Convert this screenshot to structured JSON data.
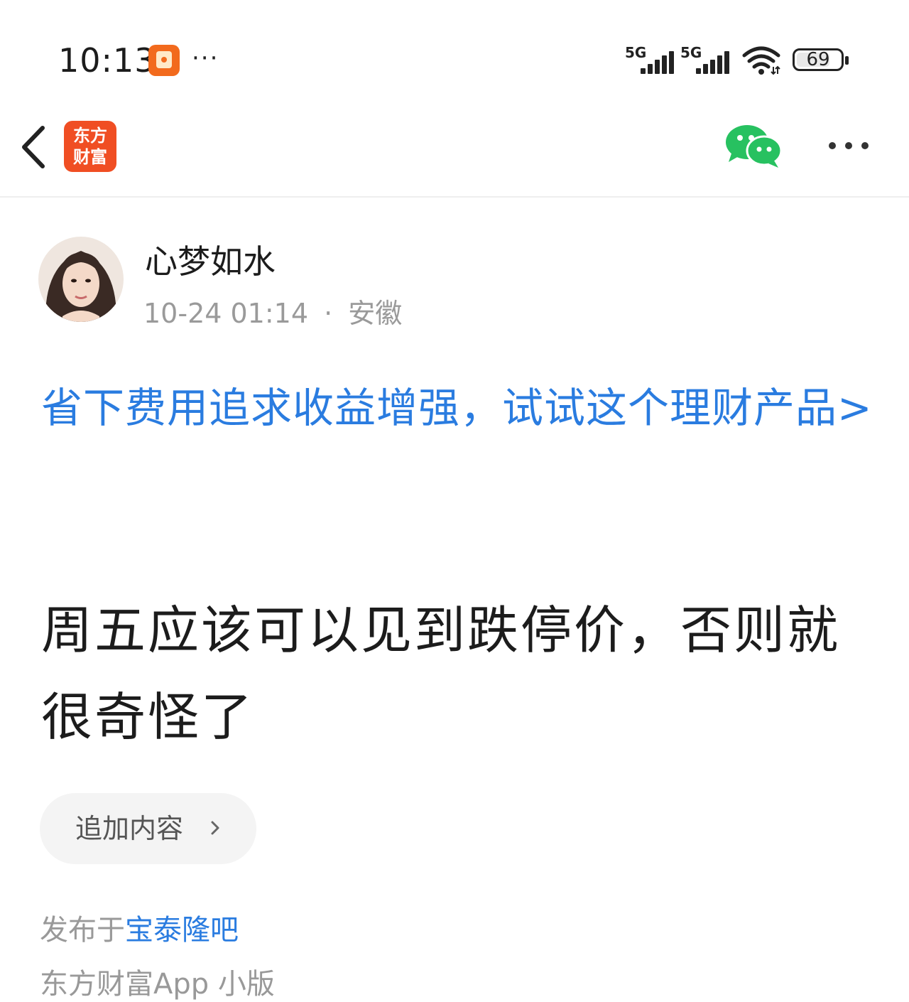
{
  "status_bar": {
    "time": "10:13",
    "network_1": "5G",
    "network_2": "5G",
    "battery": "69"
  },
  "header": {
    "logo_line1": "东方",
    "logo_line2": "财富",
    "logo_color": "#f04e23"
  },
  "post": {
    "author": "心梦如水",
    "time": "10-24 01:14",
    "separator": "·",
    "location": "安徽",
    "promo_text": "省下费用追求收益增强，试试这个理财产品>",
    "body": "周五应该可以见到跌停价，否则就很奇怪了",
    "append_label": "追加内容",
    "published_prefix": "发布于",
    "published_bar": "宝泰隆吧"
  },
  "footer": {
    "partial_text": "东方财富App 小版"
  },
  "colors": {
    "link_blue": "#2a7ce0",
    "wechat_green": "#27c160",
    "app_orange": "#f26a1d"
  }
}
